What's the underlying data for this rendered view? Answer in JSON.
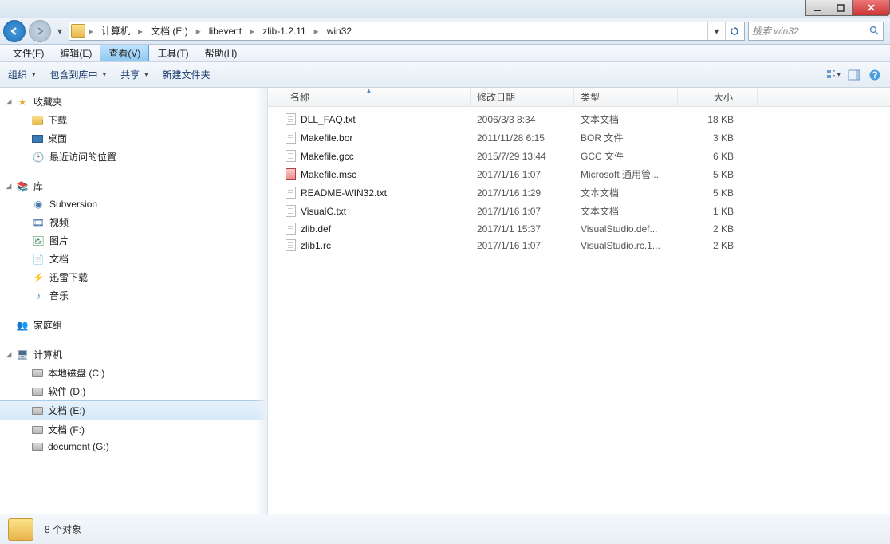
{
  "breadcrumbs": [
    "计算机",
    "文档 (E:)",
    "libevent",
    "zlib-1.2.11",
    "win32"
  ],
  "search": {
    "placeholder": "搜索 win32"
  },
  "menu": {
    "file": "文件(F)",
    "edit": "编辑(E)",
    "view": "查看(V)",
    "tools": "工具(T)",
    "help": "帮助(H)"
  },
  "toolbar": {
    "organize": "组织",
    "include": "包含到库中",
    "share": "共享",
    "newfolder": "新建文件夹"
  },
  "sidebar": {
    "favorites": {
      "label": "收藏夹",
      "items": [
        "下载",
        "桌面",
        "最近访问的位置"
      ]
    },
    "libraries": {
      "label": "库",
      "items": [
        "Subversion",
        "视频",
        "图片",
        "文档",
        "迅雷下载",
        "音乐"
      ]
    },
    "homegroup": {
      "label": "家庭组"
    },
    "computer": {
      "label": "计算机",
      "items": [
        "本地磁盘 (C:)",
        "软件 (D:)",
        "文档 (E:)",
        "文档 (F:)",
        "document (G:)"
      ]
    }
  },
  "columns": {
    "name": "名称",
    "date": "修改日期",
    "type": "类型",
    "size": "大小"
  },
  "files": [
    {
      "name": "DLL_FAQ.txt",
      "date": "2006/3/3 8:34",
      "type": "文本文档",
      "size": "18 KB",
      "icon": "txt"
    },
    {
      "name": "Makefile.bor",
      "date": "2011/11/28 6:15",
      "type": "BOR 文件",
      "size": "3 KB",
      "icon": "txt"
    },
    {
      "name": "Makefile.gcc",
      "date": "2015/7/29 13:44",
      "type": "GCC 文件",
      "size": "6 KB",
      "icon": "txt"
    },
    {
      "name": "Makefile.msc",
      "date": "2017/1/16 1:07",
      "type": "Microsoft 通用管...",
      "size": "5 KB",
      "icon": "msc"
    },
    {
      "name": "README-WIN32.txt",
      "date": "2017/1/16 1:29",
      "type": "文本文档",
      "size": "5 KB",
      "icon": "txt"
    },
    {
      "name": "VisualC.txt",
      "date": "2017/1/16 1:07",
      "type": "文本文档",
      "size": "1 KB",
      "icon": "txt"
    },
    {
      "name": "zlib.def",
      "date": "2017/1/1 15:37",
      "type": "VisualStudio.def...",
      "size": "2 KB",
      "icon": "txt"
    },
    {
      "name": "zlib1.rc",
      "date": "2017/1/16 1:07",
      "type": "VisualStudio.rc.1...",
      "size": "2 KB",
      "icon": "txt"
    }
  ],
  "status": {
    "text": "8 个对象"
  }
}
